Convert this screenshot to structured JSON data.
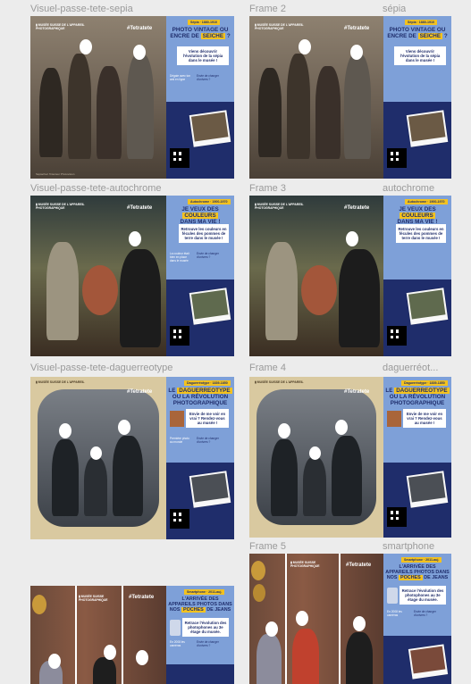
{
  "frames": [
    {
      "left_label": "Visuel-passe-tete-sepia",
      "right_frame": "Frame 2",
      "right_name": "sépia"
    },
    {
      "left_label": "Visuel-passe-tete-autochrome",
      "right_frame": "Frame 3",
      "right_name": "autochrome"
    },
    {
      "left_label": "Visuel-passe-tete-daguerreotype",
      "right_frame": "Frame 4",
      "right_name": "daguerréot..."
    },
    {
      "right_frame": "Frame 5",
      "right_name": "smartphone"
    }
  ],
  "posters": {
    "sepia": {
      "tag": "Sépia · 1880-1910",
      "headline_a": "PHOTO VINTAGE OU",
      "headline_b": "ENCRE DE",
      "highlight": "SEICHE",
      "headline_c": "?",
      "callout": "Viens découvrir l'évolution de la sépia dans le musée !",
      "hashtag": "#Tetratete",
      "note_left": "Dégaie avec ton ami en ligne",
      "note_right": "Envie de changer d'univers ?",
      "credit": "Sépiachez l'Interieur Photovision"
    },
    "autochrome": {
      "tag": "Autochrome · 1900-1970",
      "headline_a": "JE VEUX DES",
      "highlight": "COULEURS",
      "headline_b": "DANS MA VIE !",
      "callout": "Retrouve les couleurs en fécules des pommes de terre dans le musée !",
      "hashtag": "#Tetratete",
      "note_left": "La couleur était bien en place dans le musée",
      "note_right": "Envie de changer d'univers ?"
    },
    "daguerreotype": {
      "tag": "Daguerréotype · 1839-1850",
      "headline_a": "LE",
      "highlight": "DAGUERREOTYPE",
      "headline_b": "OU LA RÉVOLUTION PHOTOGRAPHIQUE",
      "callout": "Envie de me voir en vrai ? Rendez-vous au musée !",
      "hashtag": "#Tetratete",
      "note_left": "Première photo au monde",
      "note_right": "Envie de changer d'univers ?"
    },
    "smartphone": {
      "tag": "Smartphone · 2011-auj.",
      "headline_a": "L'ARRIVÉE DES APPAREILS PHOTOS DANS NOS",
      "highlight": "POCHES",
      "headline_b": "DE JEANS",
      "callout": "Retrace l'évolution des photophones au 3e étage du musée.",
      "hashtag": "#Tetratete",
      "note_left": "En 2008 les caméras",
      "note_right": "Envie de changer d'univers ?"
    }
  },
  "colors": {
    "navy": "#1f2d6b",
    "panel_blue": "#7ea0d8",
    "yellow": "#f3c21f",
    "sepia": "#6b5f52"
  }
}
